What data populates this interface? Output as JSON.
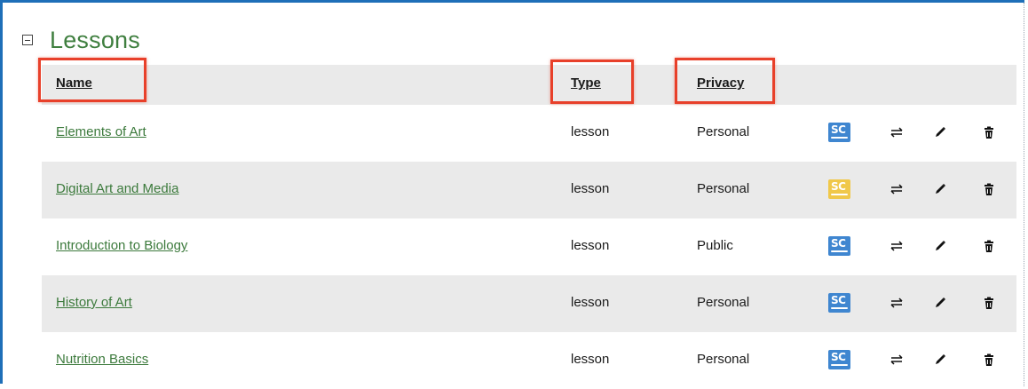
{
  "section": {
    "title": "Lessons"
  },
  "table": {
    "headers": {
      "name": "Name",
      "type": "Type",
      "privacy": "Privacy"
    },
    "rows": [
      {
        "name": "Elements of Art",
        "type": "lesson",
        "privacy": "Personal",
        "sc_color": "#3f86d0"
      },
      {
        "name": "Digital Art and Media",
        "type": "lesson",
        "privacy": "Personal",
        "sc_color": "#f0c84a"
      },
      {
        "name": "Introduction to Biology",
        "type": "lesson",
        "privacy": "Public",
        "sc_color": "#3f86d0"
      },
      {
        "name": "History of Art",
        "type": "lesson",
        "privacy": "Personal",
        "sc_color": "#3f86d0"
      },
      {
        "name": "Nutrition Basics",
        "type": "lesson",
        "privacy": "Personal",
        "sc_color": "#3f86d0"
      }
    ]
  },
  "icons": {
    "collapse": "collapse-toggle-icon",
    "screencast": "screencast-icon",
    "move": "swap-arrows-icon",
    "edit": "pencil-icon",
    "delete": "trash-icon"
  },
  "colors": {
    "frame_border": "#1e6fb8",
    "title_green": "#3f7f3f",
    "link_green": "#3c7a3c",
    "highlight_red": "#e8402a",
    "row_stripe": "#eaeaea"
  }
}
